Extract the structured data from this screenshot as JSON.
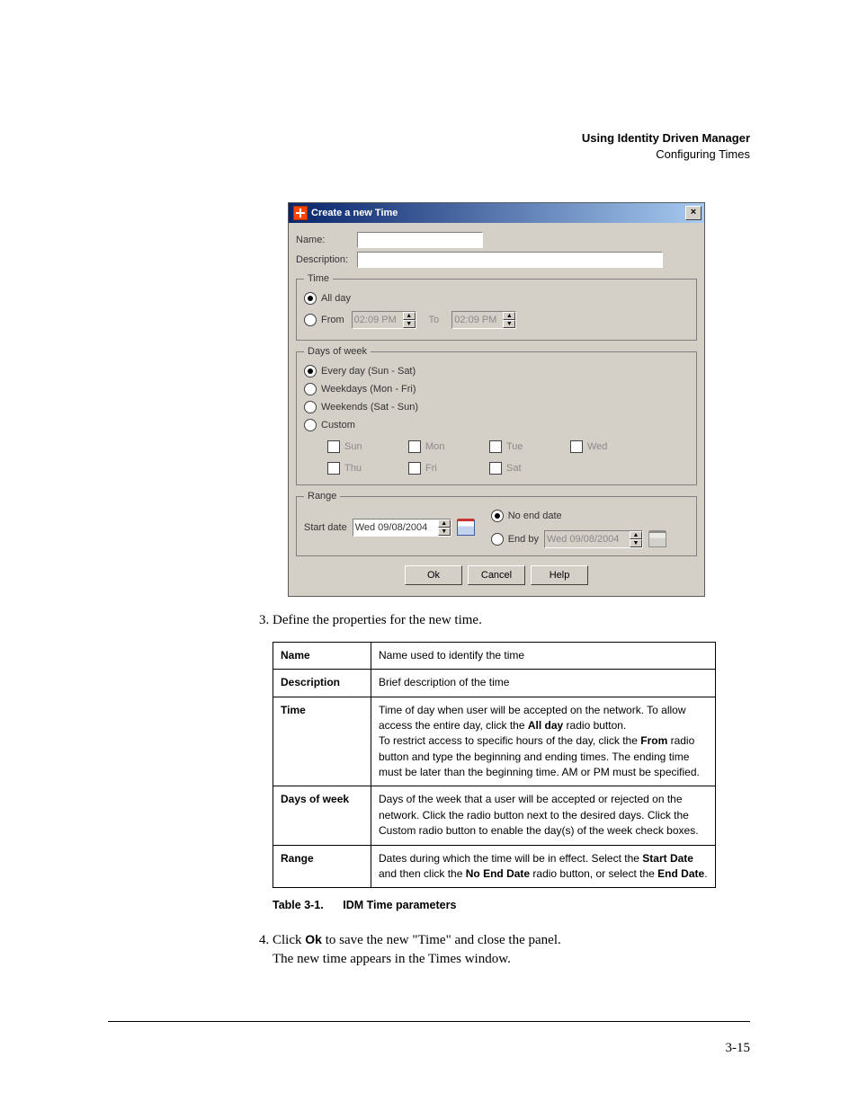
{
  "header": {
    "title": "Using Identity Driven Manager",
    "subtitle": "Configuring Times"
  },
  "dialog": {
    "title": "Create a new Time",
    "close": "×",
    "name_label": "Name:",
    "name_value": "",
    "desc_label": "Description:",
    "desc_value": "",
    "time": {
      "legend": "Time",
      "allday": "All day",
      "from": "From",
      "from_value": "02:09 PM",
      "to": "To",
      "to_value": "02:09 PM"
    },
    "days": {
      "legend": "Days of week",
      "every": "Every day (Sun - Sat)",
      "weekdays": "Weekdays (Mon - Fri)",
      "weekends": "Weekends (Sat - Sun)",
      "custom": "Custom",
      "sun": "Sun",
      "mon": "Mon",
      "tue": "Tue",
      "wed": "Wed",
      "thu": "Thu",
      "fri": "Fri",
      "sat": "Sat"
    },
    "range": {
      "legend": "Range",
      "start": "Start date",
      "start_value": "Wed 09/08/2004",
      "noend": "No end date",
      "endby": "End by",
      "end_value": "Wed 09/08/2004"
    },
    "buttons": {
      "ok": "Ok",
      "cancel": "Cancel",
      "help": "Help"
    }
  },
  "step3": "Define the properties for the new time.",
  "params": {
    "rows": [
      {
        "k": "Name",
        "v": "Name used to identify the time"
      },
      {
        "k": "Description",
        "v": "Brief description of the time"
      },
      {
        "k": "Time",
        "v": "Time of day when user will be accepted on the network. To allow access the entire day, click the <b>All day</b> radio button.<br>To restrict access to specific hours of the day, click the <b>From</b> radio button and type the beginning and ending times. The ending time must be later than the beginning time. AM or PM must be specified."
      },
      {
        "k": "Days of week",
        "v": "Days of the week that a user will be accepted or rejected on the network. Click the radio button next to the desired days. Click the Custom radio button to enable the day(s) of the week check boxes."
      },
      {
        "k": "Range",
        "v": "Dates during which the time will be in effect. Select the <b>Start Date</b> and then click the <b>No End Date</b> radio button, or select the <b>End Date</b>."
      }
    ]
  },
  "caption": {
    "num": "Table 3-1.",
    "text": "IDM Time parameters"
  },
  "step4a": "Click ",
  "step4b": " to save the new \"Time\" and close the panel.",
  "step4c": "The new time appears in the Times window.",
  "ok_bold": "Ok",
  "pagenum": "3-15"
}
